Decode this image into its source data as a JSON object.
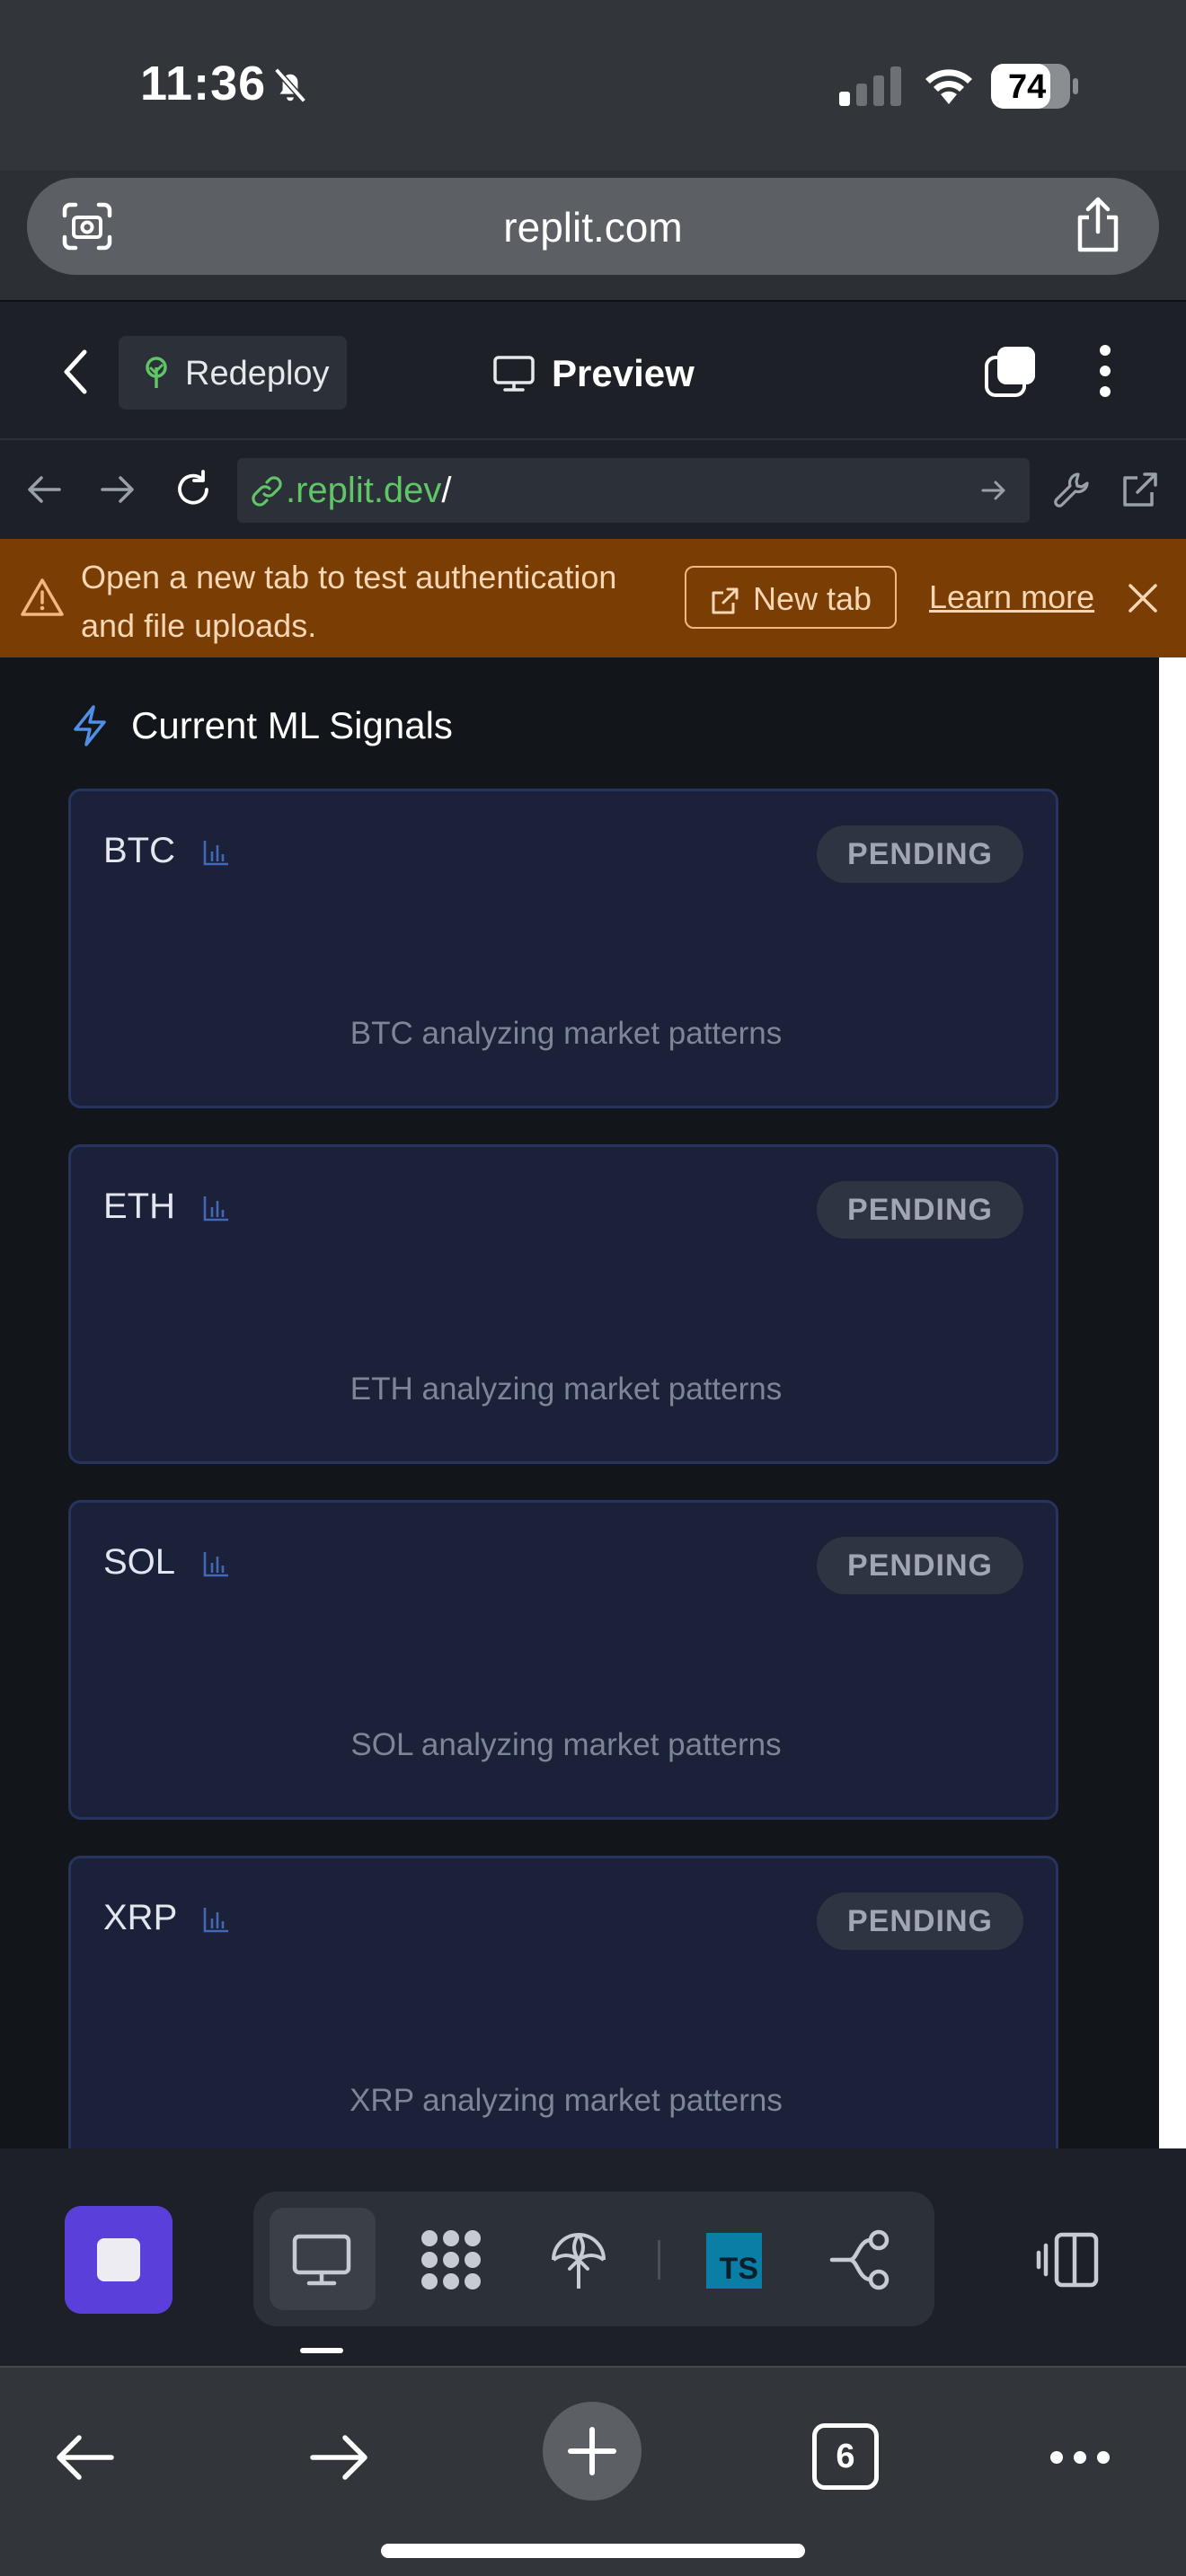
{
  "status_bar": {
    "time": "11:36",
    "battery_level": "74"
  },
  "browser": {
    "domain": "replit.com",
    "address_green": ".replit.dev",
    "address_white": "/",
    "tab_count": "6"
  },
  "app_bar": {
    "redeploy_label": "Redeploy",
    "preview_label": "Preview"
  },
  "banner": {
    "message": "Open a new tab to test authentication and file uploads.",
    "new_tab_label": "New tab",
    "learn_more_label": "Learn more"
  },
  "section": {
    "title": "Current ML Signals"
  },
  "signals": [
    {
      "symbol": "BTC",
      "status": "PENDING",
      "note": "BTC analyzing market patterns"
    },
    {
      "symbol": "ETH",
      "status": "PENDING",
      "note": "ETH analyzing market patterns"
    },
    {
      "symbol": "SOL",
      "status": "PENDING",
      "note": "SOL analyzing market patterns"
    },
    {
      "symbol": "XRP",
      "status": "PENDING",
      "note": "XRP analyzing market patterns"
    }
  ],
  "toolbar": {
    "ts_badge": "TS"
  },
  "colors": {
    "banner_bg": "#7a3e04",
    "card_bg": "#1a2139",
    "card_border": "#26345e",
    "accent_purple": "#5b3fdb",
    "link_green": "#5fc566"
  }
}
